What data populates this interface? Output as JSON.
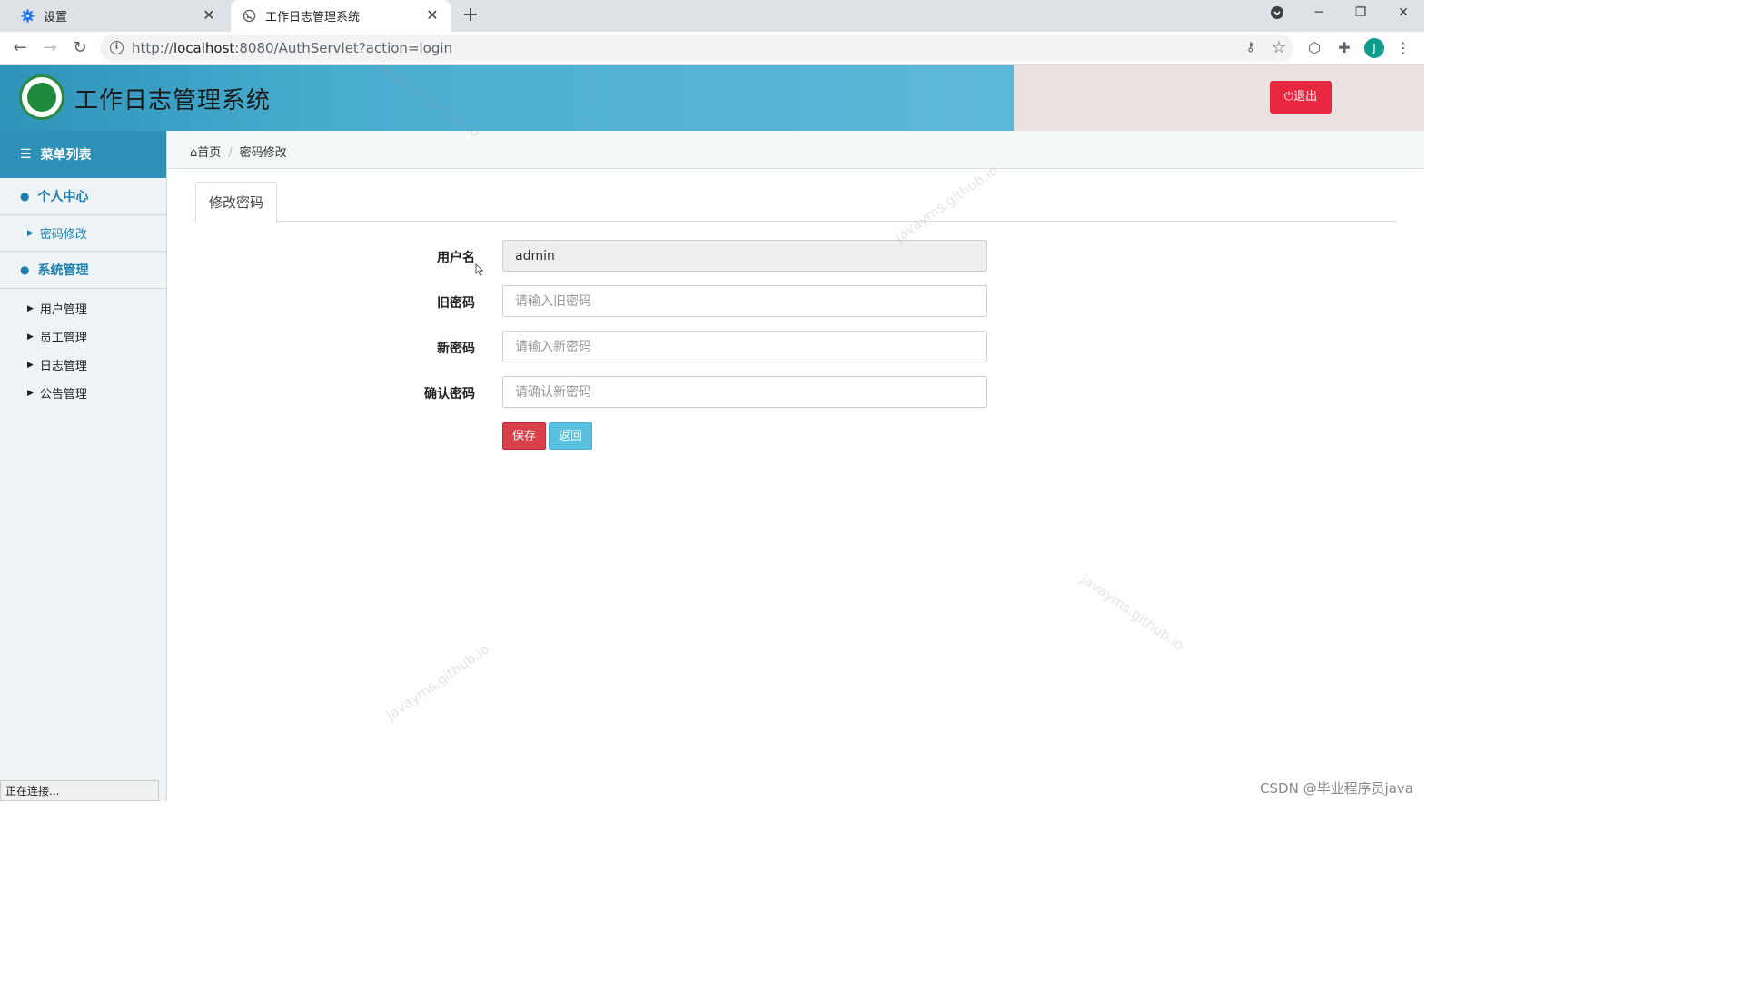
{
  "browser": {
    "tabs": [
      {
        "title": "设置",
        "icon": "gear-icon"
      },
      {
        "title": "工作日志管理系统",
        "icon": "globe-icon"
      }
    ],
    "url_prefix": "http://",
    "url_host": "localhost",
    "url_rest": ":8080/AuthServlet?action=login",
    "profile_initial": "J",
    "status_text": "正在连接..."
  },
  "app": {
    "title": "工作日志管理系统",
    "logout_label": "退出"
  },
  "sidebar": {
    "header": "菜单列表",
    "groups": [
      {
        "label": "个人中心",
        "items": [
          "密码修改"
        ]
      },
      {
        "label": "系统管理",
        "items": [
          "用户管理",
          "员工管理",
          "日志管理",
          "公告管理"
        ]
      }
    ]
  },
  "breadcrumb": {
    "home": "首页",
    "current": "密码修改"
  },
  "tab_label": "修改密码",
  "form": {
    "username": {
      "label": "用户名",
      "value": "admin"
    },
    "old_password": {
      "label": "旧密码",
      "placeholder": "请输入旧密码"
    },
    "new_password": {
      "label": "新密码",
      "placeholder": "请输入新密码"
    },
    "confirm_password": {
      "label": "确认密码",
      "placeholder": "请确认新密码"
    },
    "save_label": "保存",
    "back_label": "返回"
  },
  "watermark_text": "javayms.github.io",
  "footer_credit": "CSDN @毕业程序员java",
  "colors": {
    "header_blue": "#4aaed1",
    "sidebar_header": "#2e8fb7",
    "logout_red": "#e8283f",
    "save_red": "#d9404a",
    "back_teal": "#5bc0de",
    "menu_link": "#1c7fb0"
  }
}
